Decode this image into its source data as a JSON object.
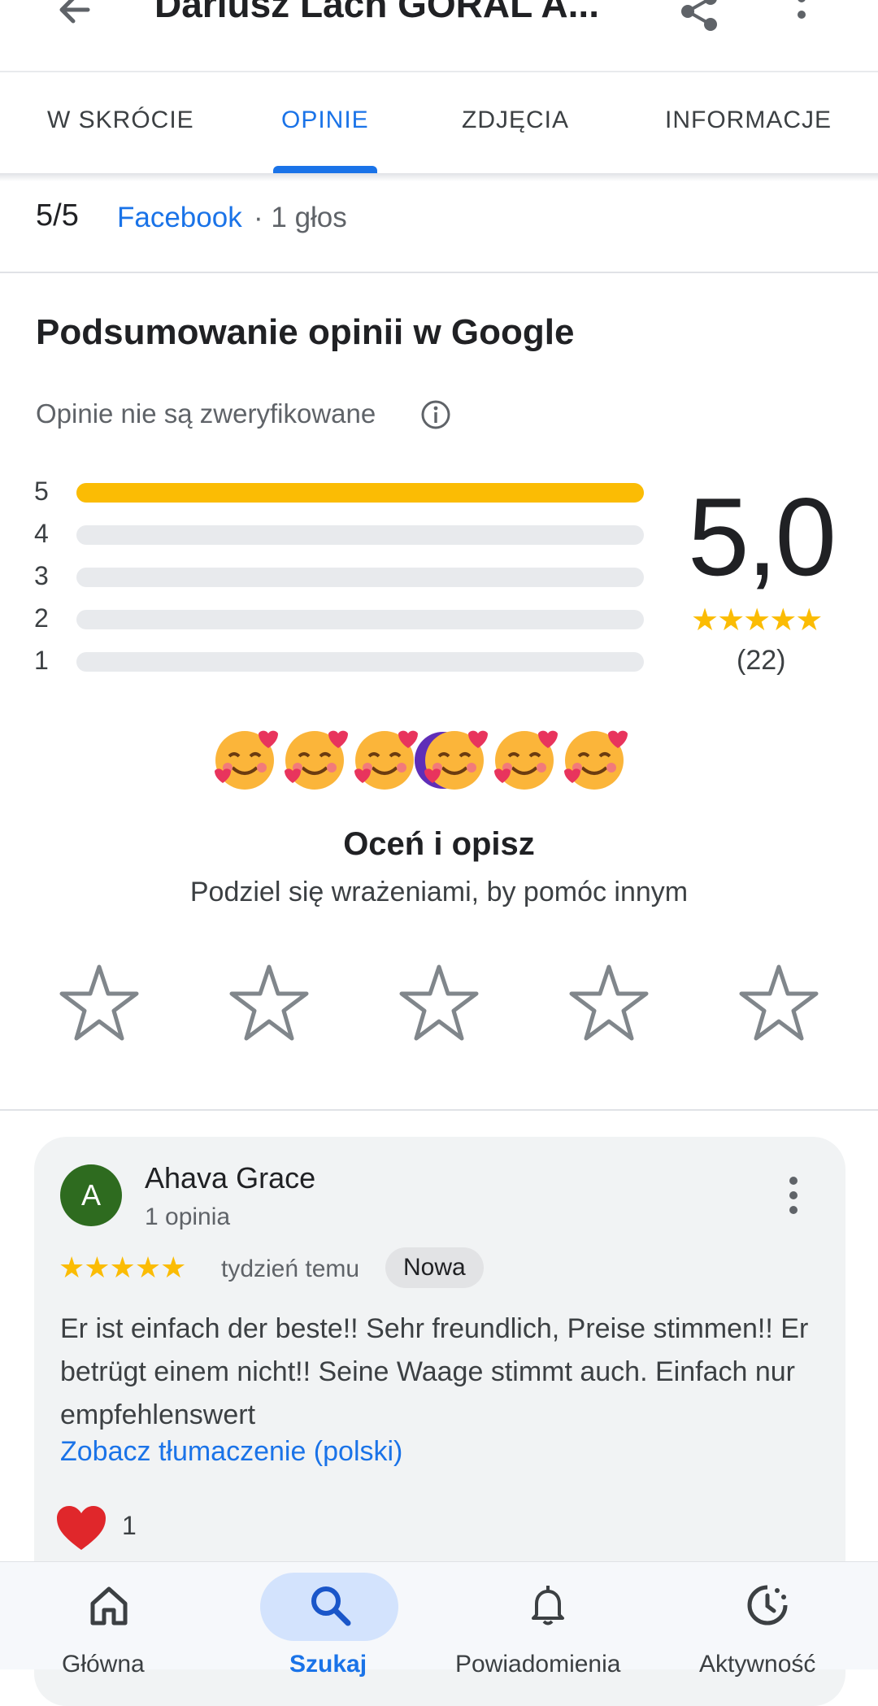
{
  "appbar": {
    "title": "Dariusz Lach GÓRAL A..."
  },
  "tabs": [
    {
      "label": "W SKRÓCIE"
    },
    {
      "label": "OPINIE"
    },
    {
      "label": "ZDJĘCIA"
    },
    {
      "label": "INFORMACJE"
    }
  ],
  "active_tab": "OPINIE",
  "facebook": {
    "score": "5/5",
    "source": "Facebook",
    "votes": "· 1 głos"
  },
  "summary": {
    "title": "Podsumowanie opinii w Google",
    "verified_note": "Opinie nie są zweryfikowane",
    "rating": "5,0",
    "stars": "★★★★★",
    "count": "(22)",
    "bars": [
      {
        "label": "5",
        "fraction": 1.0
      },
      {
        "label": "4",
        "fraction": 0
      },
      {
        "label": "3",
        "fraction": 0
      },
      {
        "label": "2",
        "fraction": 0
      },
      {
        "label": "1",
        "fraction": 0
      }
    ]
  },
  "rate": {
    "title": "Oceń i opisz",
    "subtitle": "Podziel się wrażeniami, by pomóc innym",
    "star_count": 5
  },
  "review": {
    "avatar_letter": "A",
    "author": "Ahava Grace",
    "author_reviews": "1 opinia",
    "stars": "★★★★★",
    "time": "tydzień temu",
    "badge": "Nowa",
    "text": "Er ist einfach der beste!! Sehr freundlich, Preise stimmen!! Er betrügt einem nicht!! Seine Waage stimmt auch. Einfach nur empfehlenswert",
    "translate_link": "Zobacz tłumaczenie (polski)",
    "likes": "1"
  },
  "bottom_nav": [
    {
      "label": "Główna",
      "icon": "home-icon"
    },
    {
      "label": "Szukaj",
      "icon": "search-icon"
    },
    {
      "label": "Powiadomienia",
      "icon": "bell-icon"
    },
    {
      "label": "Aktywność",
      "icon": "activity-icon"
    }
  ],
  "colors": {
    "accent": "#1a73e8",
    "star": "#fbbc04",
    "avatar": "#2e6b1f",
    "active_nav_pill": "#d3e3fd"
  }
}
